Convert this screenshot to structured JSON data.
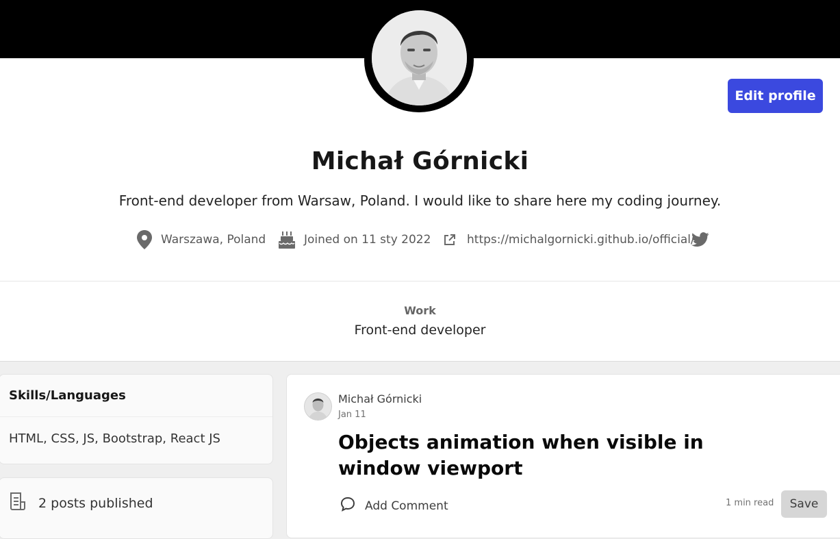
{
  "profile": {
    "name": "Michał Górnicki",
    "bio": "Front-end developer from Warsaw, Poland. I would like to share here my coding journey.",
    "edit_label": "Edit profile",
    "location": "Warszawa, Poland",
    "joined": "Joined on 11 sty 2022",
    "website": "https://michalgornicki.github.io/official/",
    "work_label": "Work",
    "work_value": "Front-end developer"
  },
  "sidebar": {
    "skills_title": "Skills/Languages",
    "skills_value": "HTML, CSS, JS, Bootstrap, React JS",
    "posts_published": "2 posts published"
  },
  "post": {
    "author": "Michał Górnicki",
    "date": "Jan 11",
    "title": "Objects animation when visible in window viewport",
    "comment_label": "Add Comment",
    "read_time": "1 min read",
    "save_label": "Save"
  },
  "icons": {
    "location": "location-pin-icon",
    "joined": "cake-icon",
    "website": "external-link-icon",
    "twitter": "twitter-icon",
    "posts": "post-document-icon",
    "comment": "comment-bubble-icon"
  },
  "colors": {
    "accent": "#3b49df",
    "header": "#000000",
    "page_bg": "#efefef"
  }
}
